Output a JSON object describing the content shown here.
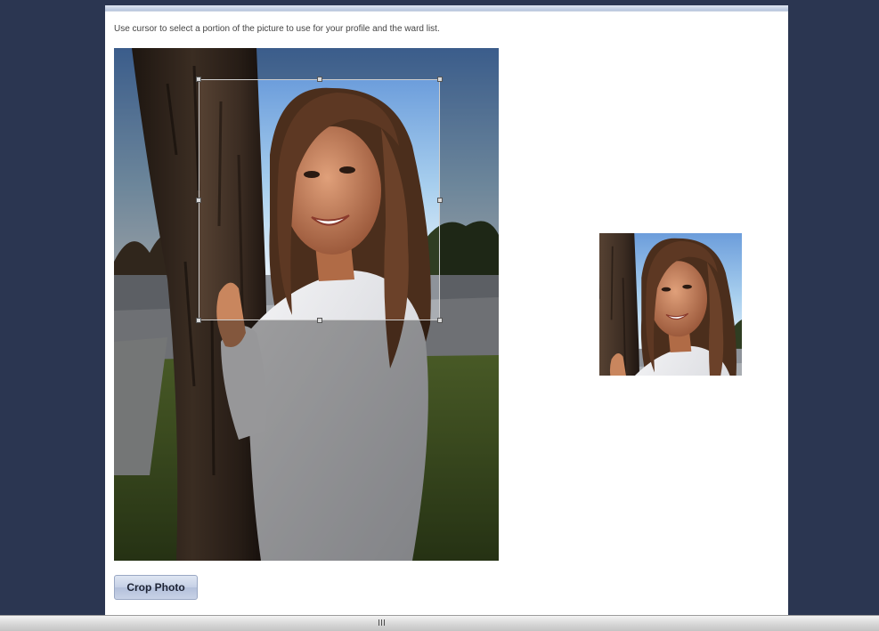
{
  "instructions": "Use cursor to select a portion of the picture to use for your profile and the ward list.",
  "crop_button_label": "Crop Photo",
  "images": {
    "source_photo": "photo-of-woman-leaning-on-tree",
    "preview_photo": "cropped-photo-preview"
  },
  "colors": {
    "page_background": "#2b3651",
    "panel_background": "#ffffff",
    "button_fill": "#c5d0e6"
  }
}
